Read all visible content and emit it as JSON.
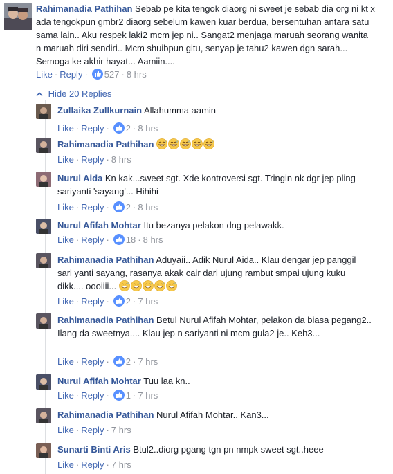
{
  "top_comment": {
    "author": "Rahimanadia Pathihan",
    "text": "Sebab pe kita tengok diaorg ni sweet je sebab dia org ni kt x ada tengokpun gmbr2 diaorg sebelum kawen kuar berdua, bersentuhan antara satu sama lain.. Aku respek laki2 mcm jep ni.. Sangat2 menjaga maruah seorang wanita n maruah diri sendiri.. Mcm shuibpun gitu, senyap je tahu2 kawen dgn sarah... Semoga ke akhir hayat... Aamiin....",
    "like": "Like",
    "reply": "Reply",
    "reactions": "527",
    "time": "8 hrs"
  },
  "hide_replies": "Hide 20 Replies",
  "replies": [
    {
      "author": "Zullaika Zullkurnain",
      "text": "Allahumma aamin",
      "like": "Like",
      "reply": "Reply",
      "reactions": "2",
      "time": "8 hrs"
    },
    {
      "author": "Rahimanadia Pathihan",
      "text": "",
      "emoji_count": 5,
      "like": "Like",
      "reply": "Reply",
      "reactions": "",
      "time": "8 hrs"
    },
    {
      "author": "Nurul Aida",
      "text": "Kn kak...sweet sgt. Xde kontroversi sgt. Tringin nk dgr jep pling sariyanti 'sayang'... Hihihi",
      "like": "Like",
      "reply": "Reply",
      "reactions": "2",
      "time": "8 hrs"
    },
    {
      "author": "Nurul Afifah Mohtar",
      "text": "Itu bezanya pelakon dng pelawakk.",
      "like": "Like",
      "reply": "Reply",
      "reactions": "18",
      "time": "8 hrs"
    },
    {
      "author": "Rahimanadia Pathihan",
      "text": "Aduyaii.. Adik Nurul Aida.. Klau dengar jep panggil sari yanti sayang, rasanya akak cair dari ujung rambut smpai ujung kuku dikk.... oooiiii...",
      "emoji_count": 5,
      "like": "Like",
      "reply": "Reply",
      "reactions": "2",
      "time": "7 hrs"
    },
    {
      "author": "Rahimanadia Pathihan",
      "text": "Betul Nurul Afifah Mohtar, pelakon da biasa pegang2.. Ilang da sweetnya.... Klau jep n sariyanti ni mcm gula2 je.. Keh3...",
      "like": "Like",
      "reply": "Reply",
      "reactions": "2",
      "time": "7 hrs"
    },
    {
      "author": "Nurul Afifah Mohtar",
      "text": "Tuu laa kn..",
      "like": "Like",
      "reply": "Reply",
      "reactions": "1",
      "time": "7 hrs"
    },
    {
      "author": "Rahimanadia Pathihan",
      "text": "Nurul Afifah Mohtar.. Kan3...",
      "like": "Like",
      "reply": "Reply",
      "reactions": "",
      "time": "7 hrs"
    },
    {
      "author": "Sunarti Binti Aris",
      "text": "Btul2..diorg pgang tgn pn nmpk sweet sgt..heee",
      "like": "Like",
      "reply": "Reply",
      "reactions": "",
      "time": "7 hrs"
    }
  ],
  "colors": {
    "link": "#365899",
    "action": "#4267b2",
    "meta": "#90949c",
    "like_badge": "#5890ff",
    "emoji": "#f7c94b"
  }
}
